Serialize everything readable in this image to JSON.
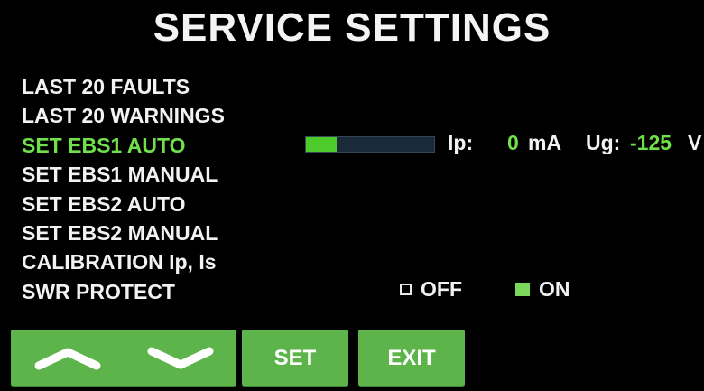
{
  "title": "SERVICE SETTINGS",
  "menu": {
    "items": [
      {
        "label": "LAST 20 FAULTS"
      },
      {
        "label": "LAST 20 WARNINGS"
      },
      {
        "label": "SET EBS1 AUTO",
        "active": true
      },
      {
        "label": "SET EBS1 MANUAL"
      },
      {
        "label": "SET EBS2 AUTO"
      },
      {
        "label": "SET EBS2 MANUAL"
      },
      {
        "label": "CALIBRATION Ip, Is"
      },
      {
        "label": "SWR PROTECT"
      }
    ]
  },
  "ebs1": {
    "ip_label": "Ip:",
    "ip_value": "0",
    "ip_unit": "mA",
    "ug_label": "Ug:",
    "ug_value": "-125",
    "ug_unit": "V",
    "bar_level": 0.24
  },
  "swr": {
    "off_label": "OFF",
    "on_label": "ON",
    "selected": "ON"
  },
  "buttons": {
    "up_icon": "chevron-up-icon",
    "down_icon": "chevron-down-icon",
    "set_label": "SET",
    "exit_label": "EXIT"
  },
  "colors": {
    "background": "#000000",
    "text": "#f2f2f2",
    "accent": "#6fe04a",
    "button": "#5cb44a"
  }
}
